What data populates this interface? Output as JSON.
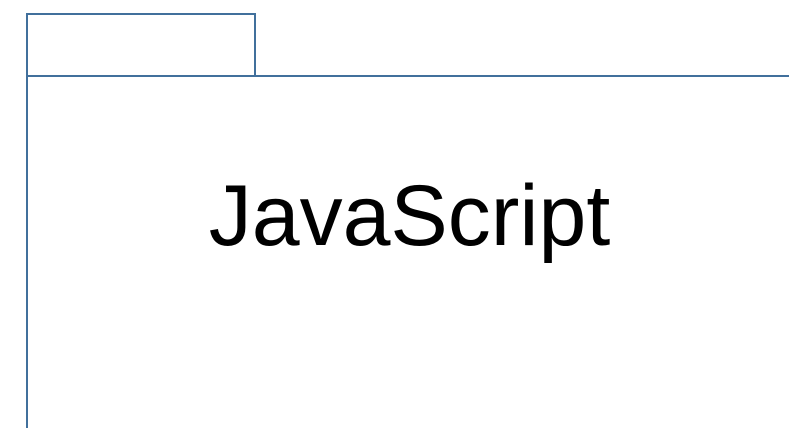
{
  "package": {
    "name": "JavaScript"
  },
  "colors": {
    "border": "#41709c",
    "text": "#000000",
    "background": "#ffffff"
  }
}
